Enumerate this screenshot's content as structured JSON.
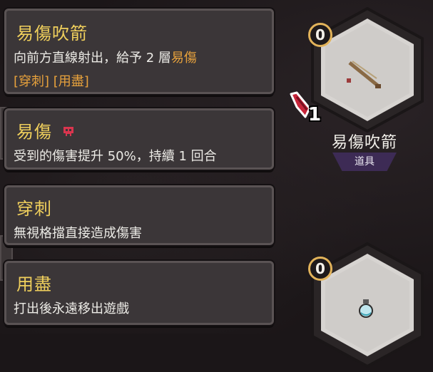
{
  "tooltips": [
    {
      "title": "易傷吹箭",
      "desc_prefix": "向前方直線射出，給予 2 層",
      "desc_highlight": "易傷",
      "tags": "[穿刺] [用盡]"
    },
    {
      "title": "易傷",
      "icon": "skull-icon",
      "desc": "受到的傷害提升 50%，持續 1 回合"
    },
    {
      "title": "穿刺",
      "desc": "無視格擋直接造成傷害"
    },
    {
      "title": "用盡",
      "desc": "打出後永遠移出遊戲"
    }
  ],
  "items": [
    {
      "cost": "0",
      "icon": "blowdart-icon",
      "name": "易傷吹箭",
      "type": "道具"
    },
    {
      "cost": "0",
      "icon": "potion-icon"
    }
  ],
  "cursor": {
    "count": "1"
  },
  "colors": {
    "title": "#efcf5c",
    "highlight": "#e8a23c",
    "panel": "#3b3638",
    "tag_purple": "#3d2b55"
  }
}
